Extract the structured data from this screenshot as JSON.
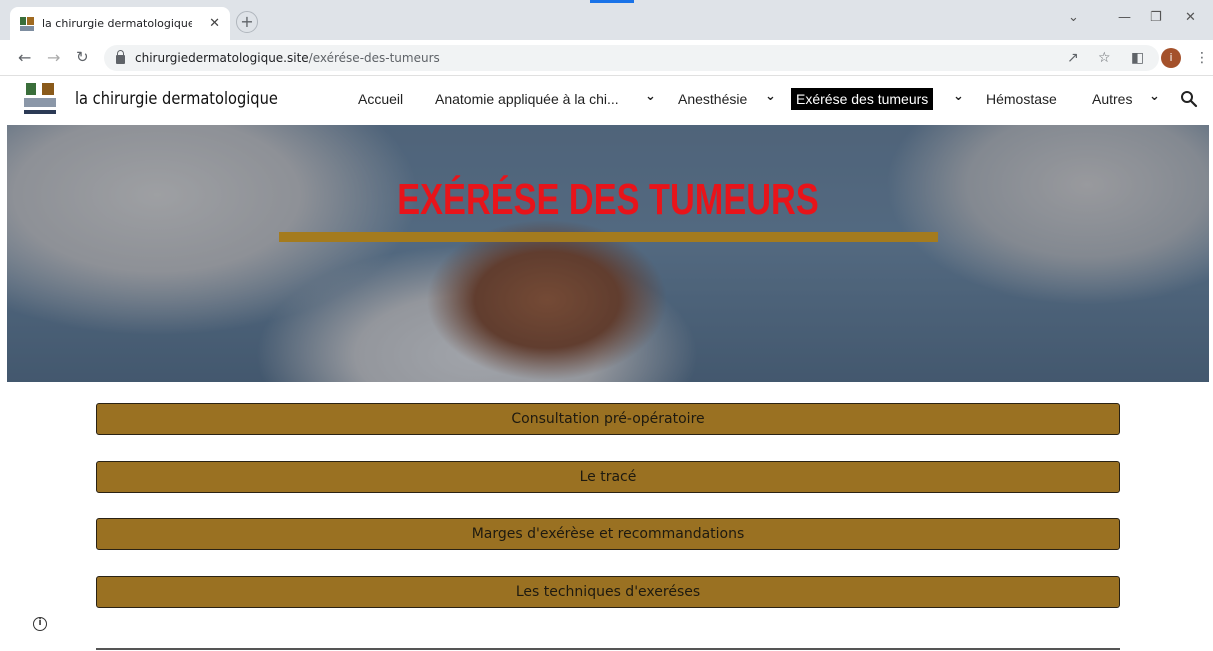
{
  "browser": {
    "tab_title": "la chirurgie dermatologique - Ex",
    "tab_close": "✕",
    "new_tab": "+",
    "url_host": "chirurgiedermatologique.site",
    "url_path": "/exérése-des-tumeurs",
    "profile_initial": "i"
  },
  "site": {
    "title": "la chirurgie dermatologique",
    "menu": [
      {
        "label": "Accueil",
        "has_dropdown": false
      },
      {
        "label": "Anatomie appliquée à la chi...",
        "has_dropdown": true
      },
      {
        "label": "Anesthésie",
        "has_dropdown": true
      },
      {
        "label": "Exérése des tumeurs",
        "has_dropdown": true,
        "active": true
      },
      {
        "label": "Hémostase",
        "has_dropdown": false
      },
      {
        "label": "Autres",
        "has_dropdown": true
      }
    ]
  },
  "hero": {
    "title": "EXÉRÉSE DES TUMEURS",
    "title_color": "#e8141a",
    "bar_color": "#a47b1e"
  },
  "buttons": [
    "Consultation pré-opératoire",
    "Le tracé",
    "Marges d'exérèse et recommandations",
    "Les techniques d'exeréses"
  ],
  "colors": {
    "button_bg": "#9a7122",
    "active_menu_bg": "#000000"
  }
}
